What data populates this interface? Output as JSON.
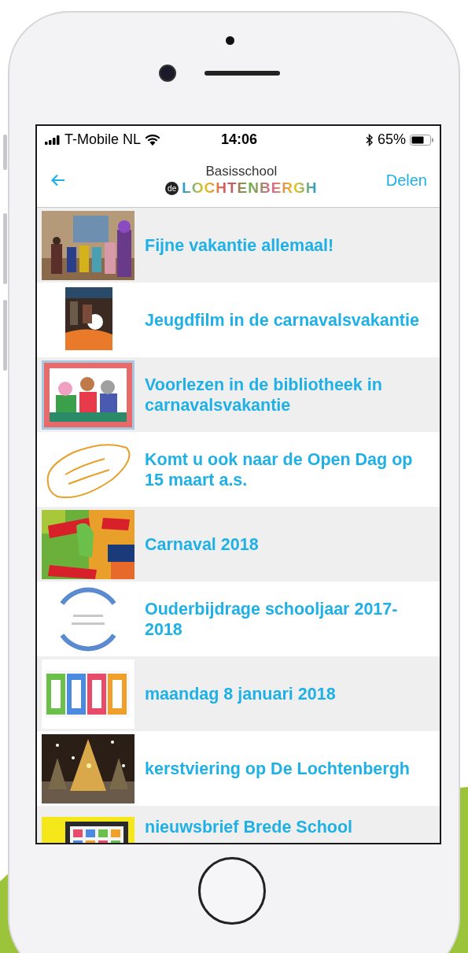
{
  "status_bar": {
    "carrier": "T-Mobile NL",
    "time": "14:06",
    "battery": "65%"
  },
  "nav": {
    "logo_top": "Basisschool",
    "logo_badge": "de",
    "logo_name": "LOCHTENBERGH",
    "action": "Delen"
  },
  "items": [
    {
      "title": "Fijne vakantie allemaal!",
      "kind": "picture"
    },
    {
      "title": "Jeugdfilm in de carnavalsvakantie",
      "kind": "picture"
    },
    {
      "title": "Voorlezen in de bibliotheek in carnavalsvakantie",
      "kind": "picture"
    },
    {
      "title": "Komt u ook naar de Open Dag op 15 maart a.s.",
      "kind": "picture"
    },
    {
      "title": "Carnaval 2018",
      "kind": "picture"
    },
    {
      "title": "Ouderbijdrage schooljaar 2017-2018",
      "kind": "picture"
    },
    {
      "title": "maandag 8 januari 2018",
      "kind": "picture"
    },
    {
      "title": "kerstviering op De Lochtenbergh",
      "kind": "picture"
    },
    {
      "title": "nieuwsbrief Brede School",
      "kind": "picture"
    }
  ]
}
